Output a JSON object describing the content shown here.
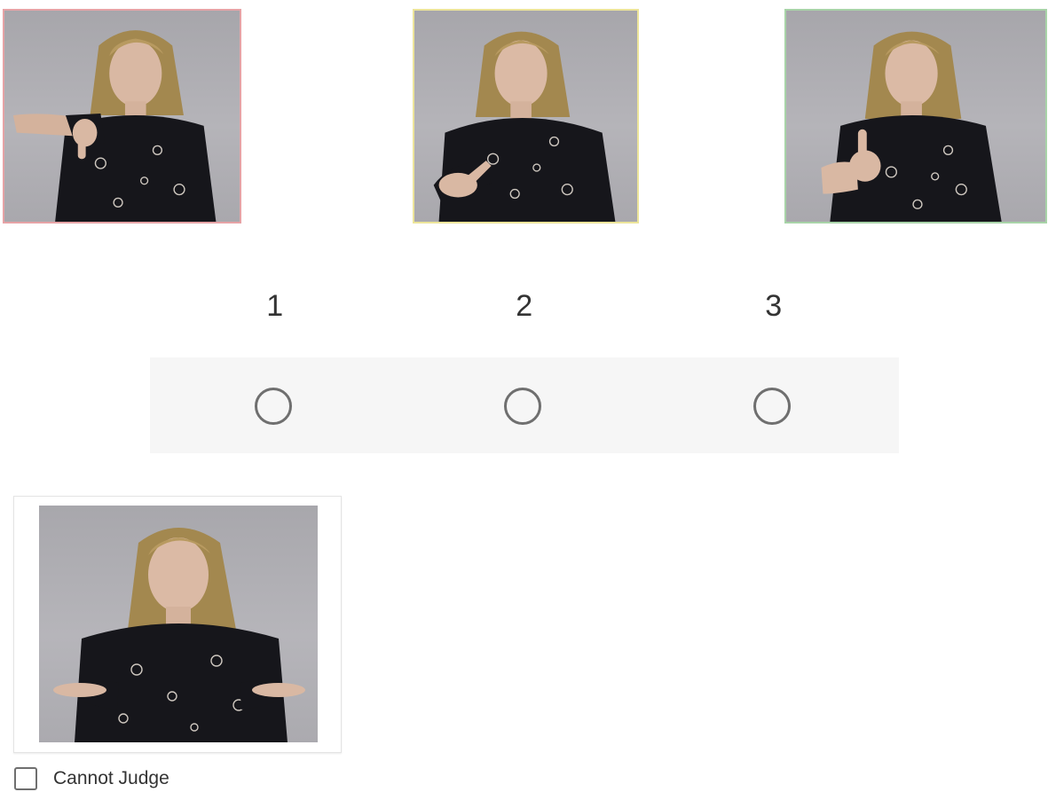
{
  "rating_options": [
    {
      "value": "1",
      "gesture": "thumbs-down",
      "border_color": "#e6a3a6"
    },
    {
      "value": "2",
      "gesture": "so-so-hand",
      "border_color": "#ece49a"
    },
    {
      "value": "3",
      "gesture": "thumbs-up",
      "border_color": "#a8d3a8"
    }
  ],
  "scale": {
    "numbers": [
      "1",
      "2",
      "3"
    ],
    "selected": null
  },
  "cannot_judge": {
    "gesture": "shrug",
    "label": "Cannot Judge",
    "checked": false
  },
  "colors": {
    "background": "#ffffff",
    "strip": "#f6f6f6",
    "control_stroke": "#6f6f6f",
    "text": "#333333"
  }
}
